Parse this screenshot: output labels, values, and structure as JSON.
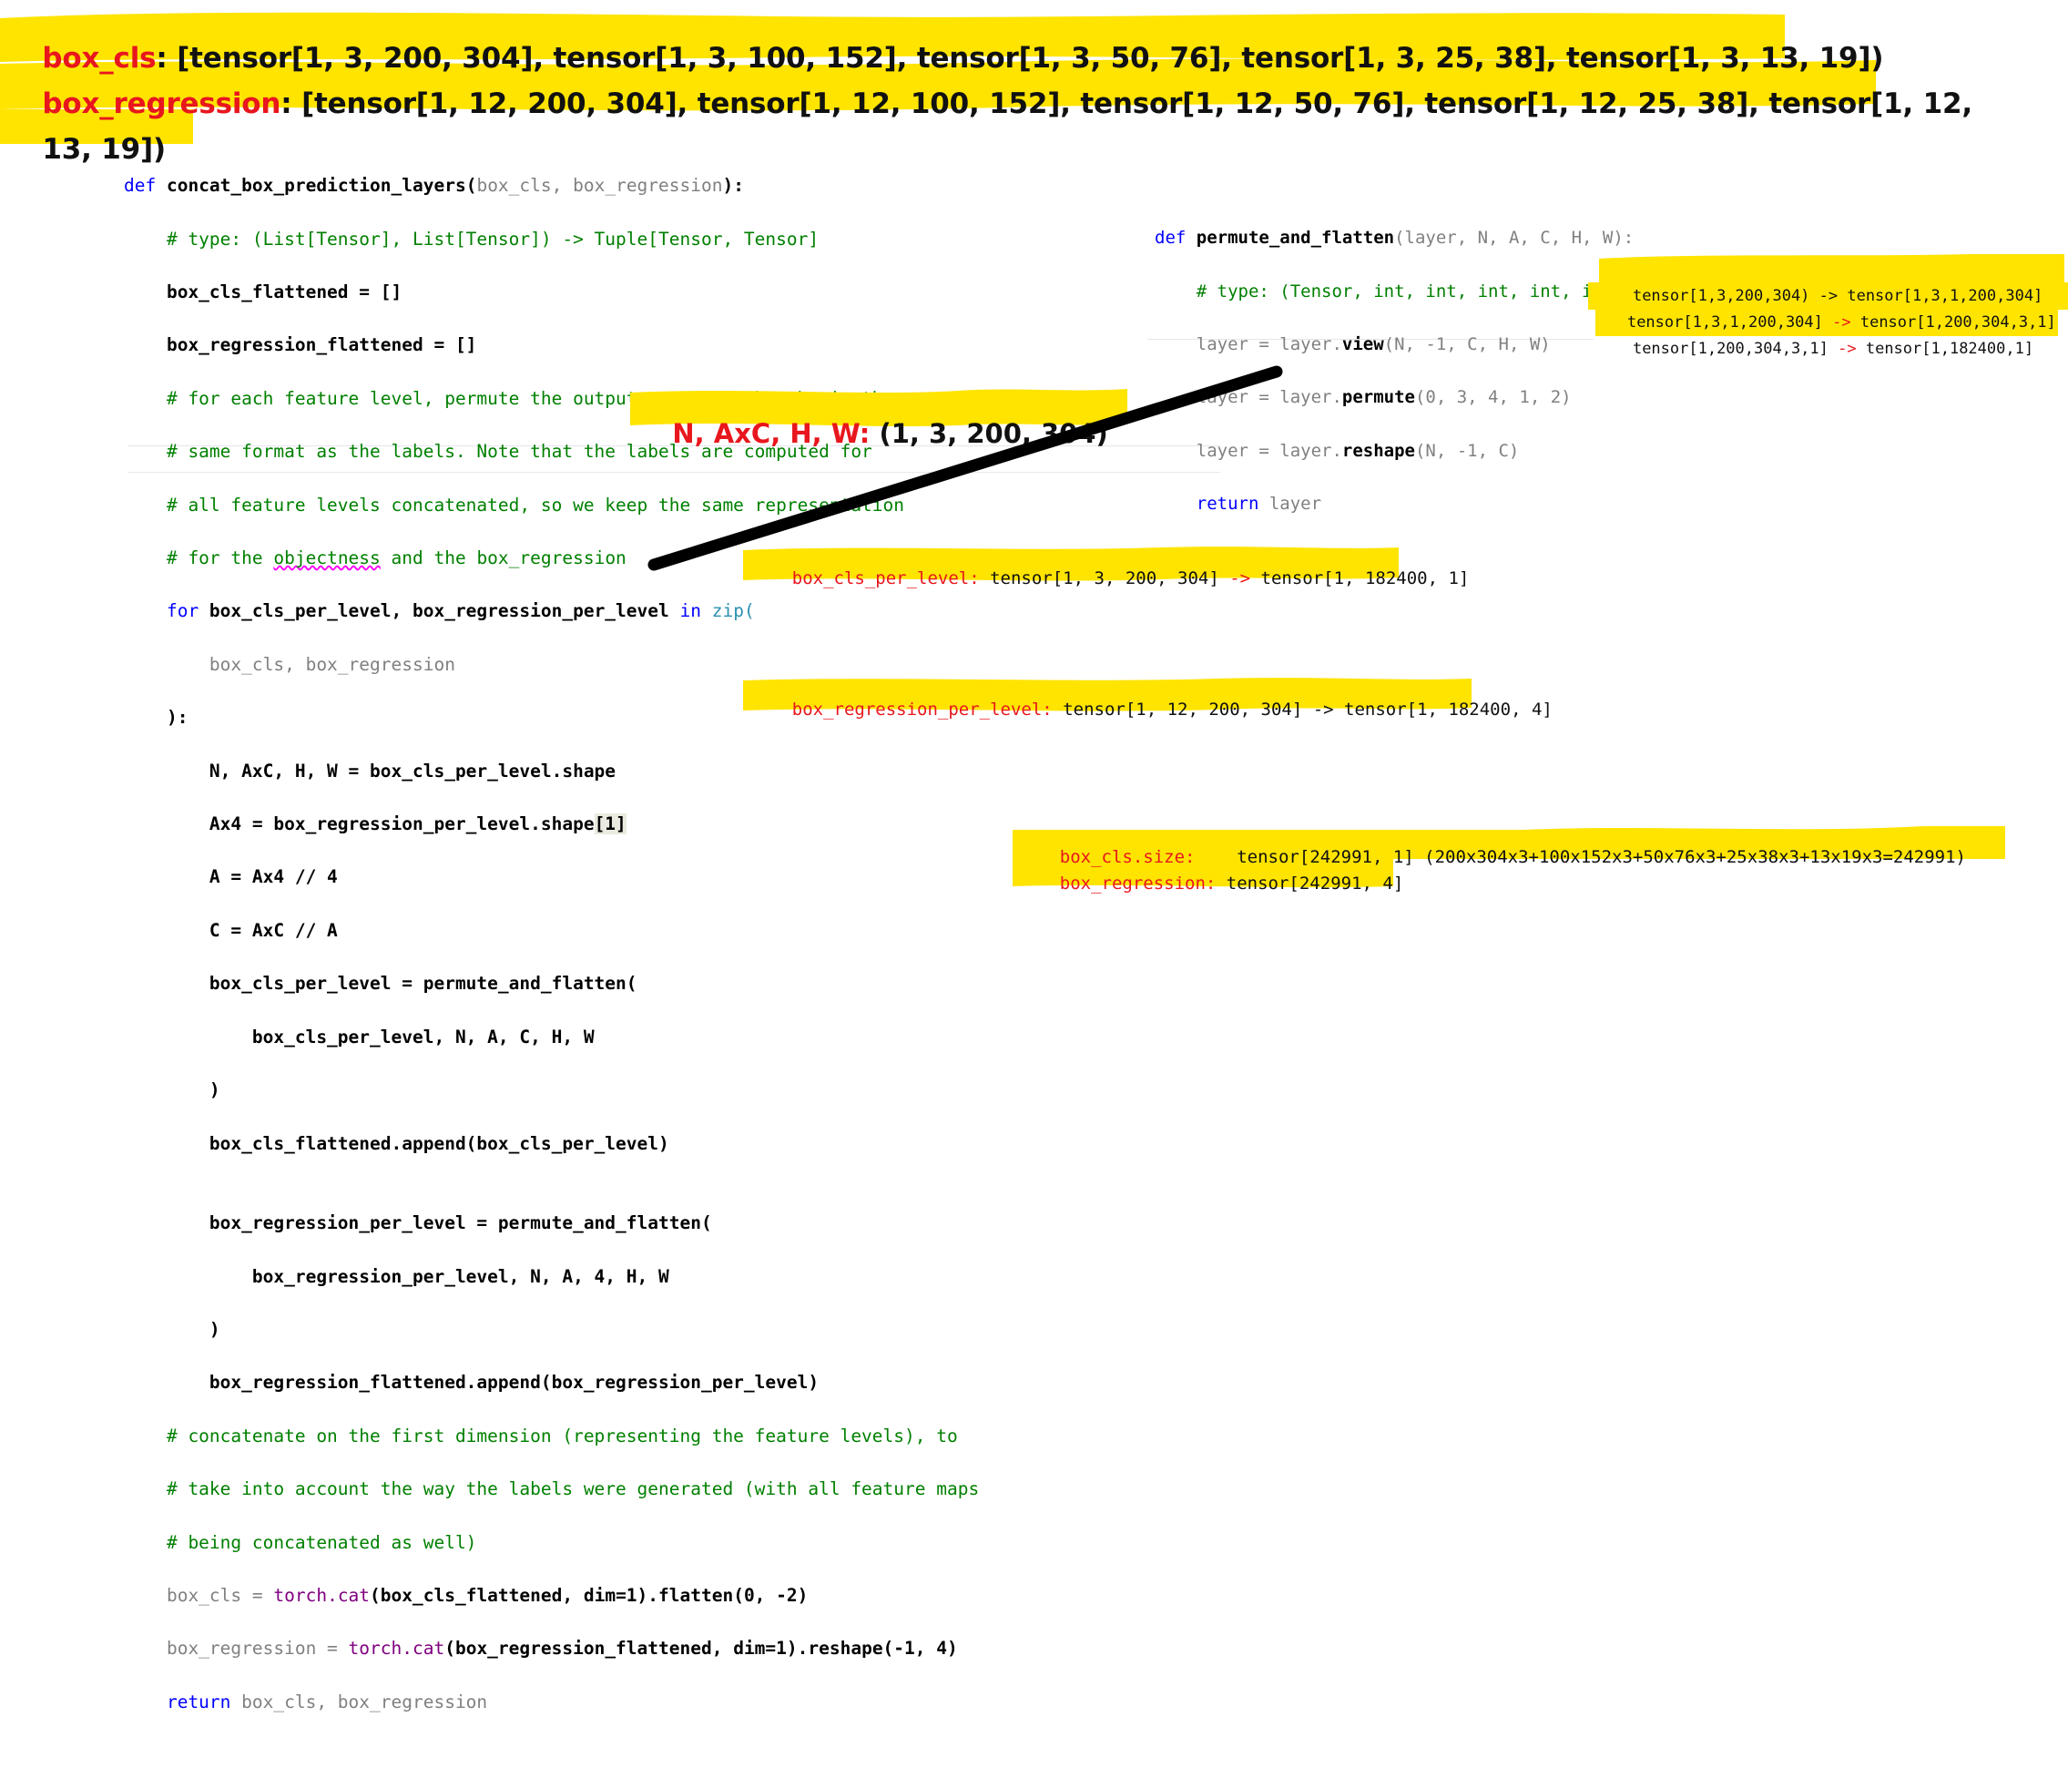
{
  "header": {
    "line1_key": "box_cls",
    "line1_value": ": [tensor[1, 3, 200, 304], tensor[1, 3, 100, 152], tensor[1, 3, 50, 76], tensor[1, 3, 25, 38], tensor[1, 3, 13, 19])",
    "line2_key": "box_regression",
    "line2_value": ": [tensor[1, 12, 200, 304], tensor[1, 12, 100, 152], tensor[1, 12, 50, 76], tensor[1, 12, 25, 38], tensor[1, 12,",
    "line3_value": "13, 19])"
  },
  "main_code": {
    "l01_kw": "def",
    "l01_name": " concat_box_prediction_layers",
    "l01_paren_open": "(",
    "l01_args": "box_cls, box_regression",
    "l01_paren_close": "):",
    "l02": "    # type: (List[Tensor], List[Tensor]) -> Tuple[Tensor, Tensor]",
    "l03": "    box_cls_flattened = []",
    "l04": "    box_regression_flattened = []",
    "l05": "    # for each feature level, permute the outputs to make them be in the",
    "l06": "    # same format as the labels. Note that the labels are computed for",
    "l07": "    # all feature levels concatenated, so we keep the same representation",
    "l08_a": "    # for the ",
    "l08_b": "objectness",
    "l08_c": " and the box_regression",
    "l09_kw": "    for",
    "l09_vars": " box_cls_per_level, box_regression_per_level ",
    "l09_in": "in",
    "l09_zip": " zip",
    "l09_paren": "(",
    "l10": "        box_cls, box_regression",
    "l11": "    ):",
    "l12": "        N, AxC, H, W = box_cls_per_level.shape",
    "l13": "        Ax4 = box_regression_per_level.shape",
    "l13_idx": "[1]",
    "l14": "        A = Ax4 // 4",
    "l15": "        C = AxC // A",
    "l16": "        box_cls_per_level = permute_and_flatten(",
    "l17": "            box_cls_per_level, N, A, C, H, W",
    "l18": "        )",
    "l19": "        box_cls_flattened.append(box_cls_per_level)",
    "l20": "",
    "l21": "        box_regression_per_level = permute_and_flatten(",
    "l22": "            box_regression_per_level, N, A, 4, H, W",
    "l23": "        )",
    "l24": "        box_regression_flattened.append(box_regression_per_level)",
    "l25": "    # concatenate on the first dimension (representing the feature levels), to",
    "l26": "    # take into account the way the labels were generated (with all feature maps",
    "l27": "    # being concatenated as well)",
    "l28_a": "    box_cls = ",
    "l28_b": "torch.cat",
    "l28_c": "(box_cls_flattened, dim=1).flatten(0, -2)",
    "l29_a": "    box_regression = ",
    "l29_b": "torch.cat",
    "l29_c": "(box_regression_flattened, dim=1).reshape(-1, 4)",
    "l30_kw": "    return",
    "l30_rest": " box_cls, box_regression"
  },
  "permute_code": {
    "l01_kw": "def",
    "l01_name": " permute_and_flatten",
    "l01_args": "(layer, N, A, C, H, W):",
    "l02": "    # type: (Tensor, int, int, int, int, int) -> Tensor",
    "l03_pre": "    layer = layer.",
    "l03_m": "view",
    "l03_post": "(N, -1, C, H, W)",
    "l04_pre": "    layer = layer.",
    "l04_m": "permute",
    "l04_post": "(0, 3, 4, 1, 2)",
    "l05_pre": "    layer = layer.",
    "l05_m": "reshape",
    "l05_post": "(N, -1, C)",
    "l06_kw": "    return",
    "l06_rest": " layer"
  },
  "annotations": {
    "permute_note1": "tensor[1,3,200,304) -> tensor[1,3,1,200,304]",
    "permute_note2_a": "tensor[1,3,1,200,304] ",
    "permute_note2_arrow": "->",
    "permute_note2_b": " tensor[1,200,304,3,1]",
    "permute_note3_a": "tensor[1,200,304,3,1] ",
    "permute_note3_arrow": "->",
    "permute_note3_b": " tensor[1,182400,1]",
    "shape_note_key": "N, AxC, H, W:",
    "shape_note_value": " (1, 3, 200, 304)",
    "cls_per_level_key": "box_cls_per_level:",
    "cls_per_level_a": " tensor[1, 3, 200, 304] ",
    "cls_per_level_arrow": "->",
    "cls_per_level_b": " tensor[1, 182400, 1]",
    "reg_per_level_key": "box_regression_per_level:",
    "reg_per_level_value": " tensor[1, 12, 200, 304] -> tensor[1, 182400, 4]",
    "size_key": "box_cls.size:",
    "size_value": "    tensor[242991, 1] (200x304x3+100x152x3+50x76x3+25x38x3+13x19x3=242991)",
    "reg_key": "box_regression:",
    "reg_value": " tensor[242991, 4]"
  },
  "colors": {
    "highlight": "#ffe400",
    "key_red": "#e8161d",
    "comment_green": "#008000",
    "keyword_blue": "#0000ff",
    "identifier_gray": "#808080",
    "pointer_black": "#000000"
  }
}
